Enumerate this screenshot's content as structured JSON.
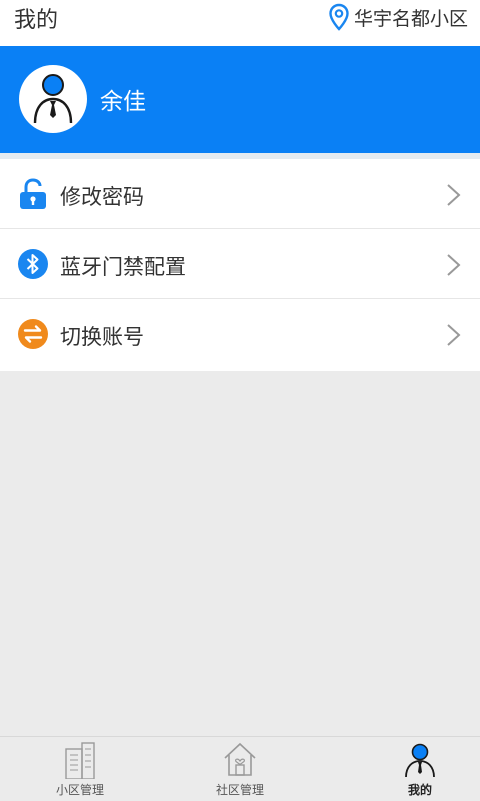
{
  "header": {
    "title": "我的",
    "location": "华宇名都小区",
    "location_icon": "map-pin-icon"
  },
  "profile": {
    "username": "余佳",
    "avatar_icon": "user-avatar-icon"
  },
  "menu": {
    "items": [
      {
        "label": "修改密码",
        "icon": "unlock-icon",
        "color": "#1a86f0"
      },
      {
        "label": "蓝牙门禁配置",
        "icon": "bluetooth-icon",
        "color": "#1a86f0"
      },
      {
        "label": "切换账号",
        "icon": "swap-icon",
        "color": "#f08a1c"
      }
    ]
  },
  "tabbar": {
    "tabs": [
      {
        "label": "小区管理",
        "icon": "building-icon",
        "active": false
      },
      {
        "label": "社区管理",
        "icon": "house-heart-icon",
        "active": false
      },
      {
        "label": "我的",
        "icon": "user-icon",
        "active": true
      }
    ]
  },
  "colors": {
    "primary": "#0a80f5",
    "background": "#ebebeb"
  }
}
